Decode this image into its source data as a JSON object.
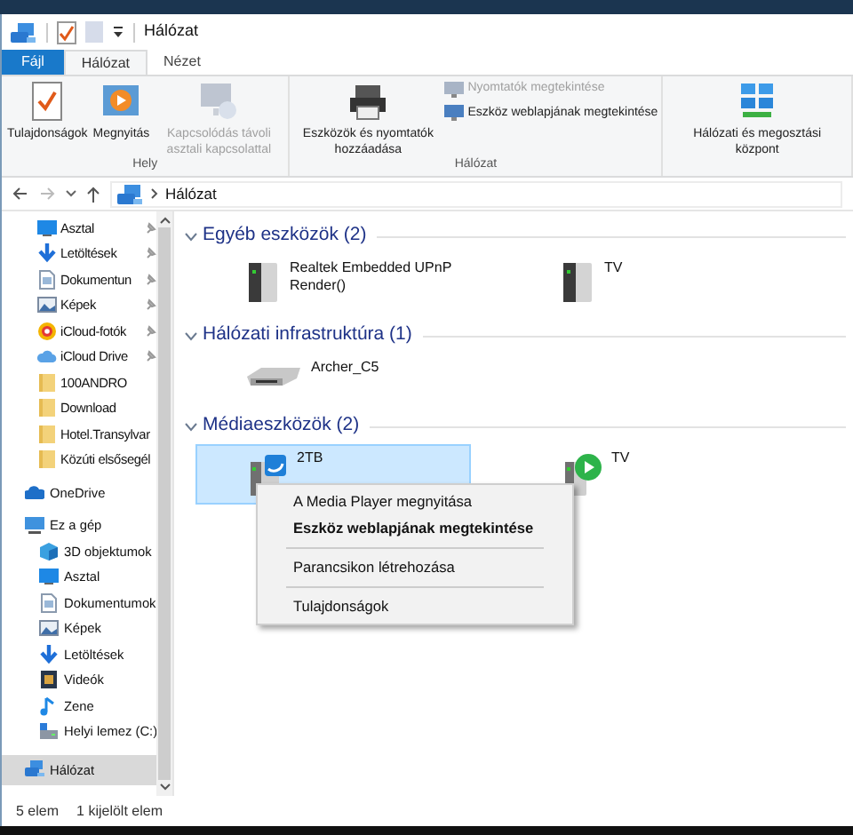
{
  "window": {
    "title": "Hálózat"
  },
  "ribbon_tabs": [
    {
      "label": "Fájl",
      "kind": "file",
      "selected": false
    },
    {
      "label": "Hálózat",
      "kind": "tab",
      "selected": true
    },
    {
      "label": "Nézet",
      "kind": "tab",
      "selected": false
    }
  ],
  "ribbon_groups": [
    {
      "label": "Hely",
      "buttons": [
        {
          "label": "Tulajdonságok",
          "kind": "properties",
          "disabled": false
        },
        {
          "label": "Megnyitás",
          "kind": "open",
          "disabled": false
        },
        {
          "label": "Kapcsolódás távoli asztali kapcsolattal",
          "kind": "remote",
          "disabled": true
        }
      ]
    },
    {
      "label": "Hálózat",
      "buttons": [
        {
          "label": "Eszközök és nyomtatók hozzáadása",
          "kind": "printer",
          "disabled": false
        }
      ],
      "small_buttons": [
        {
          "label": "Nyomtatók megtekintése",
          "disabled": true
        },
        {
          "label": "Eszköz weblapjának megtekintése",
          "disabled": false
        }
      ]
    },
    {
      "buttons": [
        {
          "label": "Hálózati és megosztási központ",
          "kind": "network",
          "disabled": false
        }
      ]
    }
  ],
  "address_bar": {
    "path": "Hálózat"
  },
  "sidebar": {
    "quick_access": [
      {
        "label": "Asztal",
        "kind": "desktop",
        "pinned": true
      },
      {
        "label": "Letöltések",
        "kind": "download",
        "pinned": true
      },
      {
        "label": "Dokumentun",
        "kind": "document",
        "pinned": true
      },
      {
        "label": "Képek",
        "kind": "pictures",
        "pinned": true
      },
      {
        "label": "iCloud-fotók",
        "kind": "photos",
        "pinned": true
      },
      {
        "label": "iCloud Drive",
        "kind": "cloud",
        "pinned": true
      },
      {
        "label": "100ANDRO",
        "kind": "folder",
        "pinned": false
      },
      {
        "label": "Download",
        "kind": "folder",
        "pinned": false
      },
      {
        "label": "Hotel.Transylvar",
        "kind": "folder",
        "pinned": false
      },
      {
        "label": "Közúti elsősegél",
        "kind": "folder",
        "pinned": false
      }
    ],
    "items": [
      {
        "label": "OneDrive",
        "kind": "onedrive",
        "selected": false
      },
      {
        "label": "Ez a gép",
        "kind": "pc",
        "selected": false,
        "children": [
          {
            "label": "3D objektumok",
            "kind": "objects3d",
            "selected": false
          },
          {
            "label": "Asztal",
            "kind": "desktop",
            "selected": false
          },
          {
            "label": "Dokumentumok",
            "kind": "document",
            "selected": false
          },
          {
            "label": "Képek",
            "kind": "pictures",
            "selected": false
          },
          {
            "label": "Letöltések",
            "kind": "download",
            "selected": false
          },
          {
            "label": "Videók",
            "kind": "videos",
            "selected": false
          },
          {
            "label": "Zene",
            "kind": "music",
            "selected": false
          },
          {
            "label": "Helyi lemez (C:)",
            "kind": "drive",
            "selected": false
          }
        ]
      },
      {
        "label": "Hálózat",
        "kind": "network",
        "selected": true
      }
    ]
  },
  "groups": [
    {
      "title": "Egyéb eszközök (2)",
      "expanded": true,
      "devices": [
        {
          "name": "Realtek Embedded UPnP Render()",
          "kind": "server",
          "selected": false
        },
        {
          "name": "TV",
          "kind": "server",
          "selected": false
        }
      ]
    },
    {
      "title": "Hálózati infrastruktúra (1)",
      "expanded": true,
      "devices": [
        {
          "name": "Archer_C5",
          "kind": "router",
          "selected": false
        }
      ]
    },
    {
      "title": "Médiaeszközök (2)",
      "expanded": true,
      "devices": [
        {
          "name": "2TB",
          "kind": "media",
          "selected": true
        },
        {
          "name": "TV",
          "kind": "player",
          "selected": false
        }
      ]
    }
  ],
  "context_menu": [
    {
      "kind": "item",
      "label": "A Media Player megnyitása",
      "default": false
    },
    {
      "kind": "item",
      "label": "Eszköz weblapjának megtekintése",
      "default": true
    },
    {
      "kind": "separator"
    },
    {
      "kind": "item",
      "label": "Parancsikon létrehozása",
      "default": false
    },
    {
      "kind": "separator"
    },
    {
      "kind": "item",
      "label": "Tulajdonságok",
      "default": false
    }
  ],
  "status_bar": {
    "items": "5 elem",
    "selected": "1 kijelölt elem"
  }
}
